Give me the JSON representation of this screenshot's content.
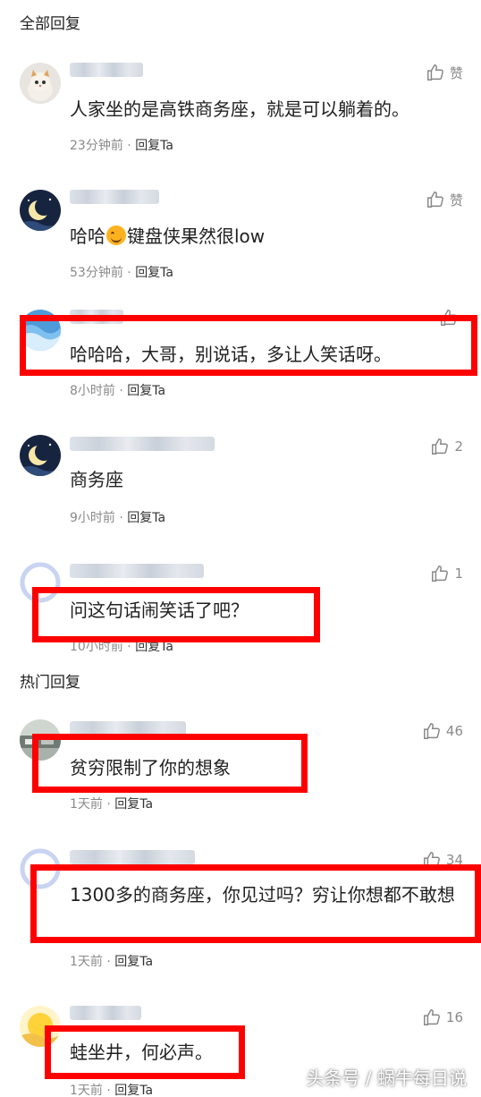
{
  "sections": {
    "all_replies": "全部回复",
    "hot_replies": "热门回复"
  },
  "labels": {
    "reply": "回复Ta",
    "like_text": "赞"
  },
  "comments": [
    {
      "text": "人家坐的是高铁商务座，就是可以躺着的。",
      "time": "23分钟前",
      "likes": "赞",
      "avatar": "cat-avatar"
    },
    {
      "text_before": "哈哈",
      "text_after": "键盘侠果然很low",
      "time": "53分钟前",
      "likes": "赞",
      "avatar": "moon-avatar"
    },
    {
      "text": "哈哈哈，大哥，别说话，多让人笑话呀。",
      "time": "8小时前",
      "likes": "",
      "avatar": "wave-avatar"
    },
    {
      "text": "商务座",
      "time": "9小时前",
      "likes": "2",
      "avatar": "moon-avatar"
    },
    {
      "text": "问这句话闹笑话了吧？",
      "time": "10小时前",
      "likes": "1",
      "avatar": "default-avatar"
    }
  ],
  "hot_comments": [
    {
      "text": "贫穷限制了你的想象",
      "time": "1天前",
      "likes": "46",
      "avatar": "photo-avatar"
    },
    {
      "text": "1300多的商务座，你见过吗？穷让你想都不敢想",
      "time": "1天前",
      "likes": "34",
      "avatar": "default-avatar"
    },
    {
      "text": "蛙坐井，何必声。",
      "time": "1天前",
      "likes": "16",
      "avatar": "sun-avatar"
    }
  ],
  "watermark": "头条号 / 蜗牛每日说",
  "colors": {
    "highlight": "#ff0000",
    "meta": "#8a8a8a"
  }
}
